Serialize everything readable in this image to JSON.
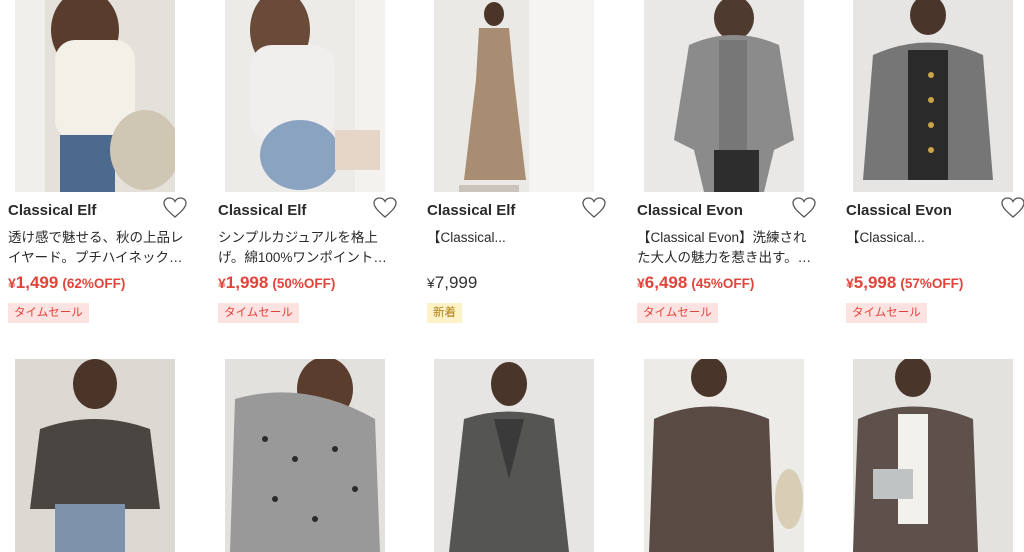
{
  "colors": {
    "sale_red": "#e0443a",
    "sale_badge_bg": "#fde2e2",
    "new_badge_bg": "#fdf1c7",
    "new_badge_text": "#b07d12"
  },
  "products": [
    {
      "brand": "Classical Elf",
      "desc_line1": "透け感で魅せる、秋の上品レ",
      "desc_line2": "イヤード。プチハイネック…",
      "yen": "¥",
      "price": "1,499",
      "discount": "(62%OFF)",
      "badge": "タイムセール"
    },
    {
      "brand": "Classical Elf",
      "desc_line1": "シンプルカジュアルを格上",
      "desc_line2": "げ。綿100%ワンポイント…",
      "yen": "¥",
      "price": "1,998",
      "discount": "(50%OFF)",
      "badge": "タイムセール"
    },
    {
      "brand": "Classical Elf",
      "desc_line1": "【Classical...",
      "desc_line2": "",
      "yen": "¥",
      "price": "7,999",
      "discount": "",
      "badge": "新着"
    },
    {
      "brand": "Classical Evon",
      "desc_line1": "【Classical Evon】洗練され",
      "desc_line2": "た大人の魅力を惹き出す。…",
      "yen": "¥",
      "price": "6,498",
      "discount": "(45%OFF)",
      "badge": "タイムセール"
    },
    {
      "brand": "Classical Evon",
      "desc_line1": "【Classical...",
      "desc_line2": "",
      "yen": "¥",
      "price": "5,998",
      "discount": "(57%OFF)",
      "badge": "タイムセール"
    }
  ]
}
